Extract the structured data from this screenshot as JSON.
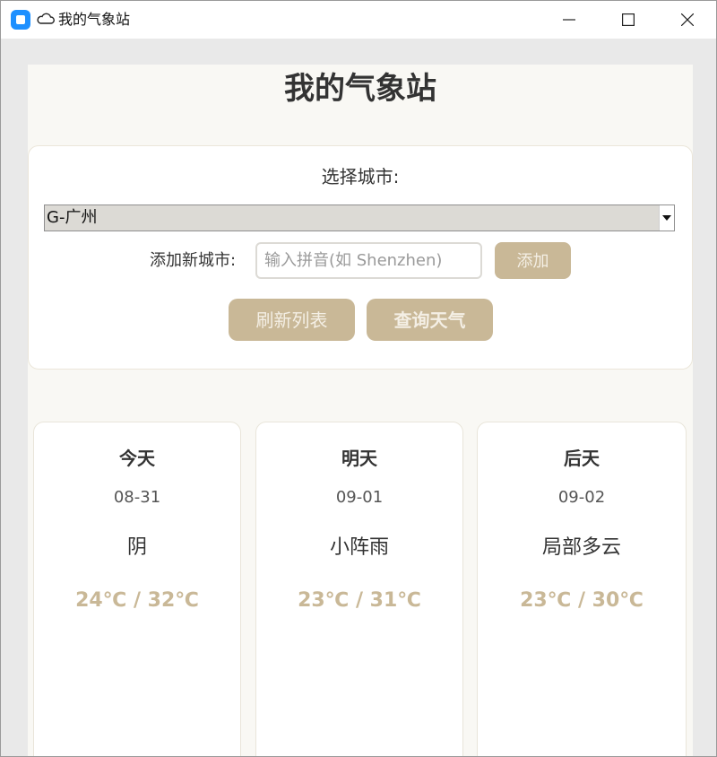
{
  "window": {
    "title": "我的气象站",
    "app_icon": "app-square-icon",
    "title_icon": "cloud-icon",
    "controls": [
      "minimize-icon",
      "maximize-icon",
      "close-icon"
    ]
  },
  "page": {
    "heading": "我的气象站"
  },
  "city_panel": {
    "choose_label": "选择城市:",
    "selected_city": "G-广州",
    "add_label": "添加新城市:",
    "add_input_value": "",
    "add_input_placeholder": "输入拼音(如 Shenzhen)",
    "add_button": "添加",
    "refresh_button": "刷新列表",
    "query_button": "查询天气"
  },
  "forecast": [
    {
      "day": "今天",
      "date": "08-31",
      "weather": "阴",
      "temp": "24℃ / 32℃"
    },
    {
      "day": "明天",
      "date": "09-01",
      "weather": "小阵雨",
      "temp": "23℃ / 31℃"
    },
    {
      "day": "后天",
      "date": "09-02",
      "weather": "局部多云",
      "temp": "23℃ / 30℃"
    }
  ],
  "colors": {
    "accent": "#c9b897",
    "page_background": "#f9f8f4",
    "window_background": "#e9e9e9",
    "select_background": "#dcdad5"
  }
}
